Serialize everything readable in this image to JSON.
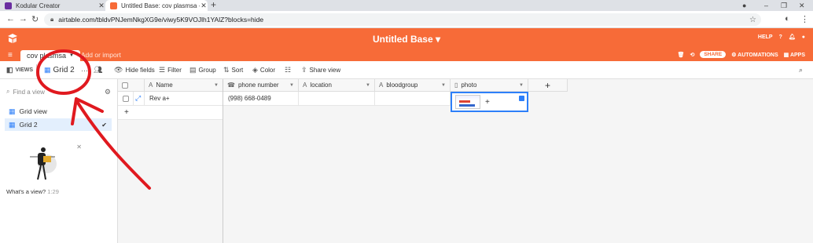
{
  "browser": {
    "tabs": [
      {
        "title": "Kodular Creator",
        "favicon_color": "#6a2ea0",
        "active": false
      },
      {
        "title": "Untitled Base: cov plasmsa - Airt",
        "favicon_color": "#f76b38",
        "active": true
      }
    ],
    "url": "airtable.com/tbldvPNJemNkgXG9e/viwy5K9VOJlh1YAlZ?blocks=hide",
    "window_controls": [
      "–",
      "❐",
      "✕"
    ]
  },
  "app": {
    "base_title": "Untitled Base",
    "header_right": {
      "help": "HELP"
    },
    "brand_color": "#f76b38"
  },
  "tablebar": {
    "table_tab": "cov plasmsa",
    "add_import": "Add or import",
    "share": "SHARE",
    "automations": "AUTOMATIONS",
    "apps": "APPS"
  },
  "viewbar": {
    "views": "VIEWS",
    "current_view": "Grid 2",
    "hide_fields": "Hide fields",
    "filter": "Filter",
    "group": "Group",
    "sort": "Sort",
    "color": "Color",
    "share_view": "Share view"
  },
  "sidebar": {
    "find_placeholder": "Find a view",
    "views": [
      {
        "label": "Grid view",
        "selected": false
      },
      {
        "label": "Grid 2",
        "selected": true
      }
    ],
    "promo_caption": "What's a view?",
    "promo_duration": "1:29"
  },
  "grid": {
    "columns": [
      {
        "label": "Name",
        "type_icon": "A"
      },
      {
        "label": "phone number",
        "type_icon": "☎"
      },
      {
        "label": "location",
        "type_icon": "A"
      },
      {
        "label": "bloodgroup",
        "type_icon": "A"
      },
      {
        "label": "photo",
        "type_icon": "▯"
      }
    ],
    "rows": [
      {
        "name": "Rev a+",
        "phone": "(998) 668-0489",
        "location": "",
        "bloodgroup": ""
      }
    ],
    "add_field": "+",
    "add_row": "+"
  },
  "annotation_color": "#e0191f"
}
